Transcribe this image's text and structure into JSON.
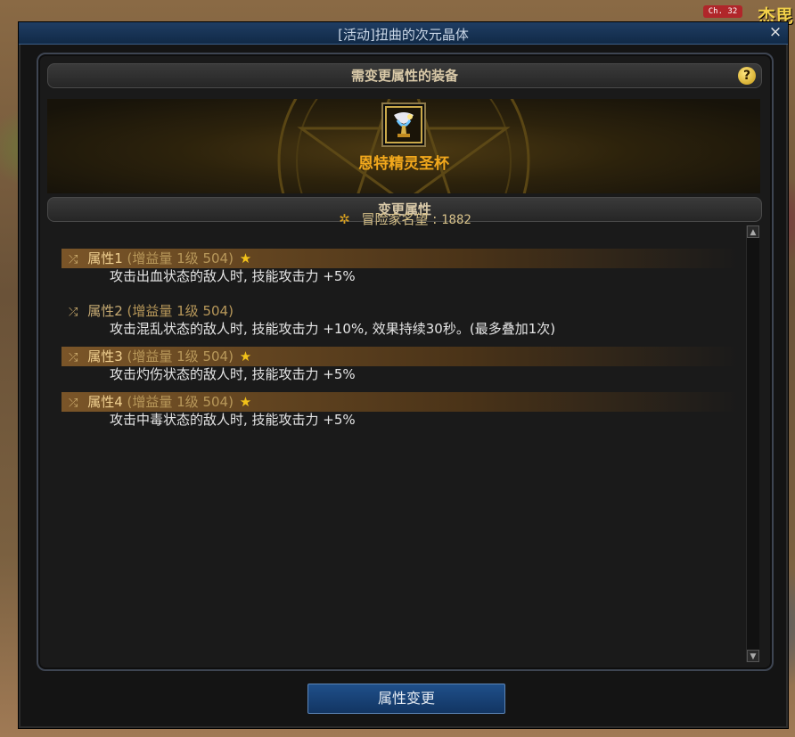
{
  "window": {
    "title": "[活动]扭曲的次元晶体",
    "close_label": "×"
  },
  "hud": {
    "channel": "Ch. 32",
    "top_fragment": "杰毘"
  },
  "equipment": {
    "header": "需变更属性的装备",
    "help_label": "?",
    "item_name": "恩特精灵圣杯"
  },
  "change_section": {
    "header": "变更属性",
    "fame_label": "冒险家名望 : ",
    "fame_value": "1882"
  },
  "attributes": [
    {
      "label": "属性1",
      "meta": "(增益量 1级 504)",
      "active": true,
      "desc": "攻击出血状态的敌人时, 技能攻击力 +5%"
    },
    {
      "label": "属性2",
      "meta": "(增益量 1级 504)",
      "active": false,
      "desc": "攻击混乱状态的敌人时, 技能攻击力 +10%, 效果持续30秒。(最多叠加1次)"
    },
    {
      "label": "属性3",
      "meta": "(增益量 1级 504)",
      "active": true,
      "desc": "攻击灼伤状态的敌人时, 技能攻击力 +5%"
    },
    {
      "label": "属性4",
      "meta": "(增益量 1级 504)",
      "active": true,
      "desc": "攻击中毒状态的敌人时, 技能攻击力 +5%"
    }
  ],
  "footer": {
    "change_button": "属性变更"
  },
  "icons": {
    "shuffle": "shuffle-icon",
    "star": "star-icon",
    "fame": "fame-icon",
    "help": "help-icon",
    "close": "close-icon"
  },
  "colors": {
    "title_bar": "#1f3d63",
    "item_name": "#f2a81c",
    "attribute_highlight": "#7a5528",
    "button": "#1f4f8a"
  }
}
